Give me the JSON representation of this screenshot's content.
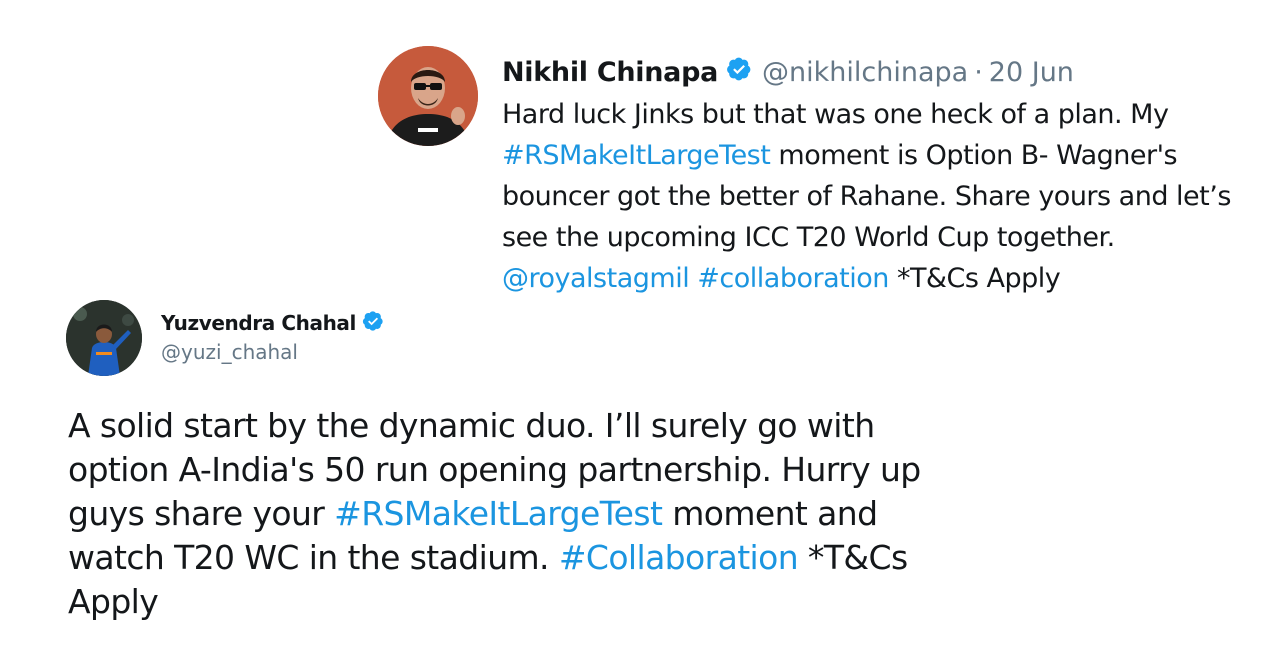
{
  "tweet1": {
    "display_name": "Nikhil Chinapa",
    "handle": "@nikhilchinapa",
    "separator": "·",
    "date": "20 Jun",
    "verified_icon": "verified-badge-icon",
    "lines": [
      [
        {
          "t": "Hard luck Jinks but that was one heck of a plan. My"
        }
      ],
      [
        {
          "t": "#RSMakeItLargeTest",
          "link": true
        },
        {
          "t": " moment is Option B- Wagner's"
        }
      ],
      [
        {
          "t": "bouncer got the better of Rahane. Share yours and let’s"
        }
      ],
      [
        {
          "t": "see the upcoming ICC T20 World Cup together."
        }
      ],
      [
        {
          "t": "@royalstagmil",
          "link": true
        },
        {
          "t": " "
        },
        {
          "t": "#collaboration",
          "link": true
        },
        {
          "t": " *T&Cs Apply"
        }
      ]
    ]
  },
  "tweet2": {
    "display_name": "Yuzvendra Chahal",
    "handle": "@yuzi_chahal",
    "verified_icon": "verified-badge-icon",
    "lines": [
      [
        {
          "t": "A solid start by the dynamic duo. I’ll surely go with"
        }
      ],
      [
        {
          "t": "option A-India's 50 run opening partnership. Hurry up"
        }
      ],
      [
        {
          "t": "guys share your "
        },
        {
          "t": "#RSMakeItLargeTest",
          "link": true
        },
        {
          "t": " moment and"
        }
      ],
      [
        {
          "t": "watch T20 WC in the stadium. "
        },
        {
          "t": "#Collaboration",
          "link": true
        },
        {
          "t": " *T&Cs"
        }
      ],
      [
        {
          "t": "Apply"
        }
      ]
    ]
  },
  "colors": {
    "link": "#1b95e0",
    "text": "#14171a",
    "secondary": "#657786",
    "verified": "#1da1f2"
  }
}
